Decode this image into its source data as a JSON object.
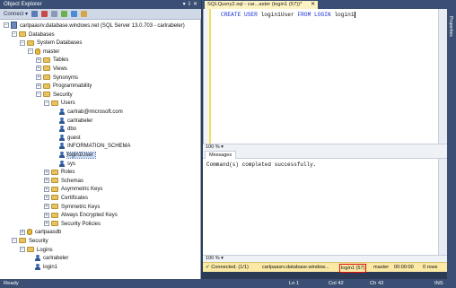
{
  "object_explorer": {
    "title": "Object Explorer",
    "title_controls": "▾ ⇩ ✕",
    "toolbar": {
      "connect_label": "Connect ▾"
    },
    "tree": [
      {
        "label": "carlpaasrv.database.windows.net (SQL Server 13.0.703 - carlrabeler)",
        "icon": "server-icon"
      },
      {
        "label": "Databases",
        "icon": "folder-icon"
      },
      {
        "label": "System Databases",
        "icon": "folder-icon"
      },
      {
        "label": "master",
        "icon": "database-icon"
      },
      {
        "label": "Tables",
        "icon": "folder-icon"
      },
      {
        "label": "Views",
        "icon": "folder-icon"
      },
      {
        "label": "Synonyms",
        "icon": "folder-icon"
      },
      {
        "label": "Programmability",
        "icon": "folder-icon"
      },
      {
        "label": "Security",
        "icon": "folder-icon"
      },
      {
        "label": "Users",
        "icon": "folder-icon"
      },
      {
        "label": "carlrab@microsoft.com",
        "icon": "user-icon"
      },
      {
        "label": "carlrabeler",
        "icon": "user-icon"
      },
      {
        "label": "dbo",
        "icon": "user-icon"
      },
      {
        "label": "guest",
        "icon": "user-icon"
      },
      {
        "label": "INFORMATION_SCHEMA",
        "icon": "user-icon"
      },
      {
        "label": "login1User",
        "icon": "user-icon"
      },
      {
        "label": "sys",
        "icon": "user-icon"
      },
      {
        "label": "Roles",
        "icon": "folder-icon"
      },
      {
        "label": "Schemas",
        "icon": "folder-icon"
      },
      {
        "label": "Asymmetric Keys",
        "icon": "folder-icon"
      },
      {
        "label": "Certificates",
        "icon": "folder-icon"
      },
      {
        "label": "Symmetric Keys",
        "icon": "folder-icon"
      },
      {
        "label": "Always Encrypted Keys",
        "icon": "folder-icon"
      },
      {
        "label": "Security Policies",
        "icon": "folder-icon"
      },
      {
        "label": "carlpaasdb",
        "icon": "database-icon"
      },
      {
        "label": "Security",
        "icon": "folder-icon"
      },
      {
        "label": "Logins",
        "icon": "folder-icon"
      },
      {
        "label": "carlrabeler",
        "icon": "login-icon"
      },
      {
        "label": "login1",
        "icon": "login-icon"
      }
    ]
  },
  "editor": {
    "tab_label": "SQLQuery2.sql - car...aster (login1 (57))*",
    "tab_close": "✕",
    "code_tokens": [
      "CREATE",
      "USER",
      "login1User",
      "FROM",
      "LOGIN",
      "login1"
    ],
    "zoom_top": "100 %",
    "results_tab": "Messages",
    "message": "Command(s) completed successfully.",
    "zoom_bottom": "100 %"
  },
  "query_status": {
    "connected": "Connected. (1/1)",
    "server": "carlpaasrv.database.window...",
    "login": "login1 (57)",
    "database": "master",
    "elapsed": "00:00:00",
    "rows": "0 rows"
  },
  "status_bar": {
    "ready": "Ready",
    "ln": "Ln 1",
    "col": "Col 42",
    "ch": "Ch 42",
    "ins": "INS"
  },
  "side_panel": {
    "label": "Properties"
  },
  "colors": {
    "chrome": "#3b4f74",
    "tab_active": "#fdf3c2",
    "query_status": "#fbe9a5",
    "highlight": "#e01010"
  }
}
